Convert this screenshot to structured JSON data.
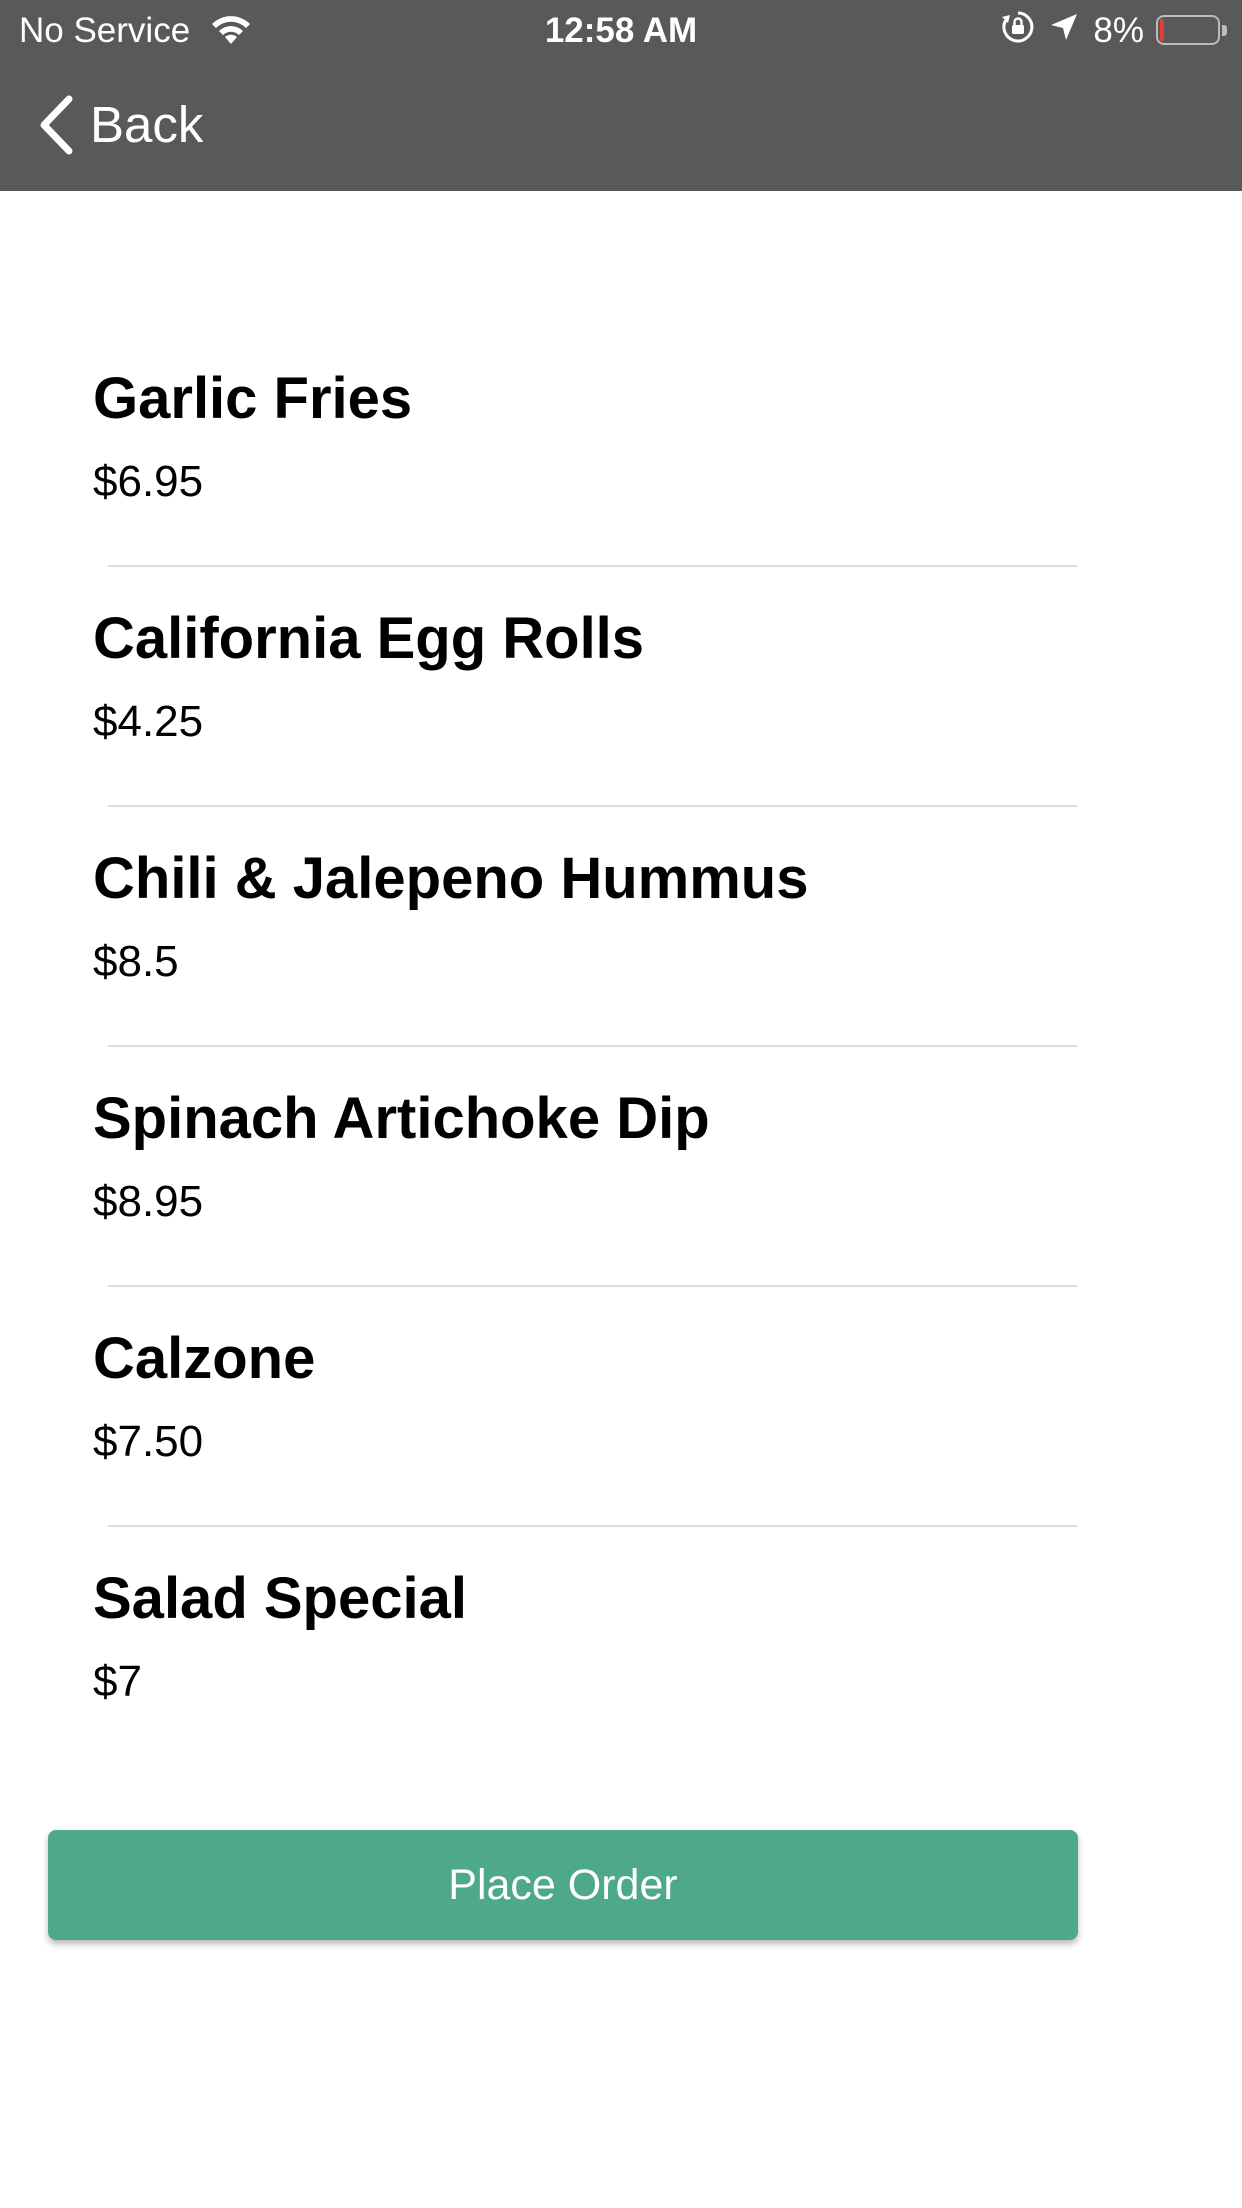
{
  "status_bar": {
    "carrier": "No Service",
    "time": "12:58 AM",
    "battery_percent_label": "8%",
    "battery_level": 0.08,
    "battery_color": "#e53b30",
    "icons": [
      "wifi-icon",
      "orientation-lock-icon",
      "location-arrow-icon",
      "battery-icon"
    ]
  },
  "nav": {
    "back_label": "Back",
    "header_color": "#595959"
  },
  "menu_items": [
    {
      "name": "Garlic Fries",
      "price": "$6.95"
    },
    {
      "name": "California Egg Rolls",
      "price": "$4.25"
    },
    {
      "name": "Chili & Jalepeno Hummus",
      "price": "$8.5"
    },
    {
      "name": "Spinach Artichoke Dip",
      "price": "$8.95"
    },
    {
      "name": "Calzone",
      "price": "$7.50"
    },
    {
      "name": "Salad Special",
      "price": "$7"
    }
  ],
  "actions": {
    "place_order_label": "Place Order",
    "accent_color": "#4ea98a"
  }
}
